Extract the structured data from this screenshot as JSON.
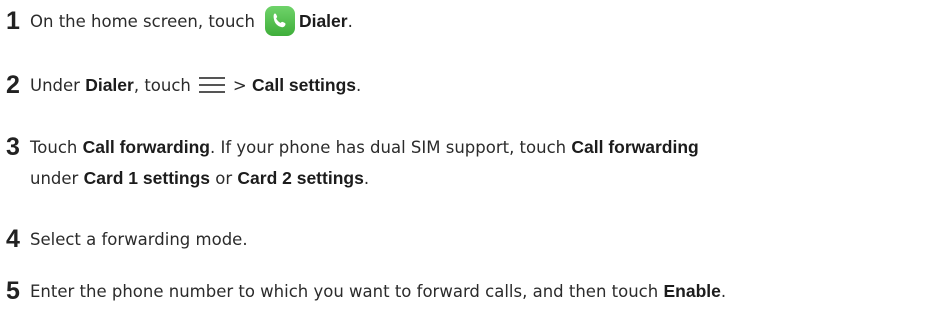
{
  "steps": [
    {
      "number": "1",
      "text_a": "On the home screen, touch",
      "icon": "phone-dialer-icon",
      "bold_a": "Dialer",
      "text_end": "."
    },
    {
      "number": "2",
      "text_a": "Under ",
      "bold_a": "Dialer",
      "text_b": ", touch",
      "icon": "menu-icon",
      "text_c": "> ",
      "bold_b": "Call settings",
      "text_end": "."
    },
    {
      "number": "3",
      "text_a": "Touch ",
      "bold_a": "Call forwarding",
      "text_b": ". If your phone has dual SIM support, touch ",
      "bold_b": "Call forwarding",
      "line2_a": "under ",
      "bold_c": "Card 1 settings",
      "line2_b": " or ",
      "bold_d": "Card 2 settings",
      "text_end": "."
    },
    {
      "number": "4",
      "text_a": "Select a forwarding mode."
    },
    {
      "number": "5",
      "text_a": "Enter the phone number to which you want to forward calls, and then touch ",
      "bold_a": "Enable",
      "text_end": "."
    }
  ],
  "colors": {
    "dialer_icon": "#4fbf4a",
    "text": "#2b2b2b"
  }
}
